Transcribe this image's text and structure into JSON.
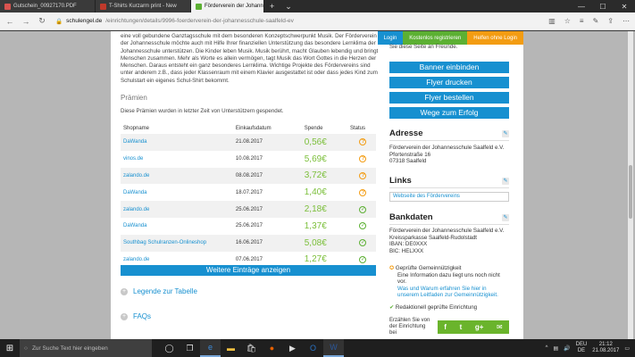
{
  "browser": {
    "tabs": [
      {
        "title": "Gutschein_00927170.PDF",
        "favicon_color": "#d9534f"
      },
      {
        "title": "T-Shirts Kurzarm print - New",
        "favicon_color": "#c0392b"
      },
      {
        "title": "Förderverein der Johann",
        "favicon_color": "#5cb033",
        "active": true
      }
    ],
    "url_domain": "schulengel.de",
    "url_path": "/einrichtungen/details/9996-foerderverein-der-johannesschule-saalfeld-ev"
  },
  "topbar": {
    "login": "Login",
    "register": "Kostenlos registrieren",
    "help_no_login": "Helfen ohne Login"
  },
  "intro_text": "eine voll gebundene Ganztagsschule mit dem besonderen Konzeptschwerpunkt Musik. Der Förderverein der Johannesschule möchte auch mit Hilfe Ihrer finanziellen Unterstützung das besondere Lernklima der Johannesschule unterstützen. Die Kinder leben Musik. Musik berührt, macht Glauben lebendig und bringt Menschen zusammen. Mehr als Worte es allein vermögen, tagt Musik das Wort Gottes in die Herzen der Menschen. Daraus entsteht ein ganz besonderes Lernklima. Wichtige Projekte des Fördervereins sind unter anderem z.B., dass jeder Klassenraum mit einem Klavier ausgestattet ist oder dass jedes Kind zum Schulstart ein eigenes Schul-Shirt bekommt.",
  "rewards": {
    "heading": "Prämien",
    "subtitle": "Diese Prämien wurden in letzter Zeit von Unterstützern gespendet.",
    "columns": {
      "shop": "Shopname",
      "date": "Einkaufsdatum",
      "amount": "Spende",
      "status": "Status"
    },
    "rows": [
      {
        "shop": "DaWanda",
        "date": "21.08.2017",
        "amount": "0,56€",
        "status": "pending"
      },
      {
        "shop": "vinos.de",
        "date": "10.08.2017",
        "amount": "5,69€",
        "status": "pending"
      },
      {
        "shop": "zalando.de",
        "date": "08.08.2017",
        "amount": "3,72€",
        "status": "pending"
      },
      {
        "shop": "DaWanda",
        "date": "18.07.2017",
        "amount": "1,40€",
        "status": "pending"
      },
      {
        "shop": "zalando.de",
        "date": "25.06.2017",
        "amount": "2,18€",
        "status": "confirmed"
      },
      {
        "shop": "DaWanda",
        "date": "25.06.2017",
        "amount": "1,37€",
        "status": "confirmed"
      },
      {
        "shop": "Southbag Schulranzen-Onlineshop",
        "date": "16.06.2017",
        "amount": "5,08€",
        "status": "confirmed"
      },
      {
        "shop": "zalando.de",
        "date": "07.06.2017",
        "amount": "1,27€",
        "status": "confirmed"
      }
    ],
    "more_button": "Weitere Einträge anzeigen"
  },
  "legend_link": "Legende zur Tabelle",
  "faq_link": "FAQs",
  "sidebar": {
    "top_text": "Sie diese Seite an Freunde.",
    "buttons": [
      "Banner einbinden",
      "Flyer drucken",
      "Flyer bestellen",
      "Wege zum Erfolg"
    ],
    "address": {
      "heading": "Adresse",
      "name": "Förderverein der Johannesschule Saalfeld e.V.",
      "street": "Pfortenstraße 16",
      "city": "07318 Saalfeld"
    },
    "links": {
      "heading": "Links",
      "website": "Webseite des Fördervereins"
    },
    "bank": {
      "heading": "Bankdaten",
      "line1": "Förderverein der Johannesschule Saalfeld e.V.",
      "line2": "Kreissparkasse Saalfeld-Rudolstadt",
      "iban": "IBAN: DE0XXX",
      "bic": "BIC: HELXXX"
    },
    "nonprofit": {
      "label": "Geprüfte Gemeinnützigkeit",
      "text": "Eine Information dazu liegt uns noch nicht vor.",
      "link": "Was und Warum erfahren Sie hier in unserem Leitfaden zur Gemeinnützigkeit.",
      "verified": "Redaktionell geprüfte Einrichtung"
    },
    "share_text": "Erzählen Sie von der Einrichtung bei"
  },
  "taskbar": {
    "search_placeholder": "Zur Suche Text hier eingeben",
    "lang": "DEU",
    "lang2": "DE",
    "time": "21:12",
    "date": "21.08.2017"
  }
}
